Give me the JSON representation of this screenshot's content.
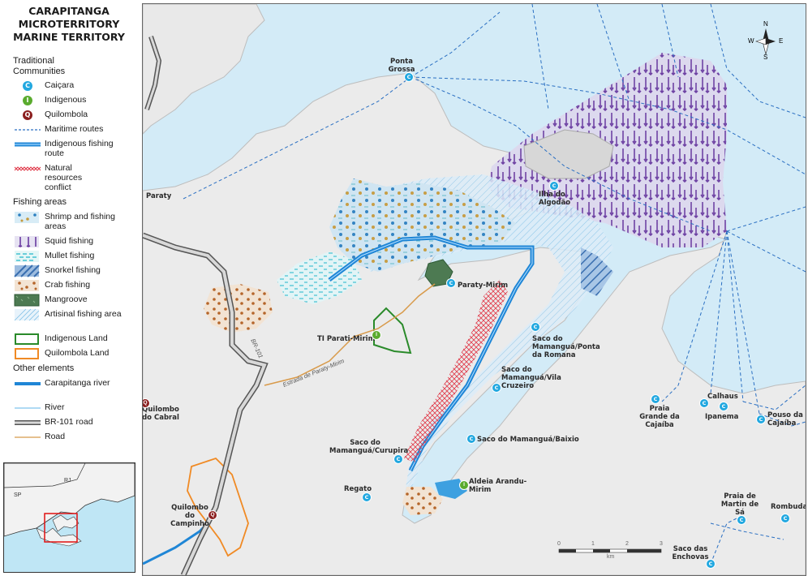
{
  "legend": {
    "title_lines": [
      "CARAPITANGA",
      "MICROTERRITORY",
      "MARINE TERRITORY"
    ],
    "traditional_communities_title": "Traditional Communities",
    "community_types": [
      {
        "label": "Caiçara",
        "letter": "C",
        "color": "#22a8e0"
      },
      {
        "label": "Indigenous",
        "letter": "I",
        "color": "#5aab2e"
      },
      {
        "label": "Quilombola",
        "letter": "Q",
        "color": "#8b1f1f"
      }
    ],
    "routes": [
      {
        "label": "Maritime routes"
      },
      {
        "label": "Indigenous fishing route"
      },
      {
        "label": "Natural resources conflict"
      }
    ],
    "fishing_areas_title": "Fishing areas",
    "fishing_areas": [
      {
        "label": "Shrimp and fishing areas"
      },
      {
        "label": "Squid fishing"
      },
      {
        "label": "Mullet fishing"
      },
      {
        "label": "Snorkel fishing"
      },
      {
        "label": "Crab fishing"
      },
      {
        "label": "Mangroove"
      },
      {
        "label": "Artisinal fishing area"
      },
      {
        "label": "Indigenous Land"
      },
      {
        "label": "Quilombola Land"
      }
    ],
    "other_elements_title": "Other elements",
    "other_elements": [
      {
        "label": "Carapitanga river"
      },
      {
        "label": "River"
      },
      {
        "label": "BR-101 road"
      },
      {
        "label": "Road"
      }
    ],
    "inset": {
      "sp": "SP",
      "rj": "RJ"
    }
  },
  "map": {
    "places": {
      "ponta_grossa": "Ponta Grossa",
      "paraty": "Paraty",
      "ilha_algodao": "Ilha do Algodão",
      "paraty_mirim": "Paraty-Mirim",
      "ti_parati_mirim": "TI Parati-Mirim",
      "saco_ponta_romana": "Saco do Mamanguá/Ponta da Romana",
      "saco_vila_cruzeiro": "Saco do Mamanguá/Vila Cruzeiro",
      "saco_baixio": "Saco do Mamanguá/Baixio",
      "saco_curupira": "Saco do Mamanguá/Curupira",
      "regato": "Regato",
      "aldeia": "Aldeia Arandu-Mirim",
      "quilombo_cabral": "Quilombo do Cabral",
      "quilombo_campinho": "Quilombo do Campinho",
      "praia_grande": "Praia Grande da Cajaíba",
      "calhaus": "Calhaus",
      "ipanema": "Ipanema",
      "pouso": "Pouso da Cajaíba",
      "praia_martin": "Praia de Martin de Sá",
      "rombuda": "Rombuda",
      "saco_enchovas": "Saco das Enchovas"
    },
    "roads": {
      "br101": "BR-101",
      "estrada": "Estrada de Paraty-Mirim"
    },
    "compass": {
      "n": "N",
      "s": "S",
      "e": "E",
      "w": "W"
    },
    "scale": {
      "ticks": [
        "0",
        "1",
        "2",
        "3"
      ],
      "unit": "km"
    }
  }
}
